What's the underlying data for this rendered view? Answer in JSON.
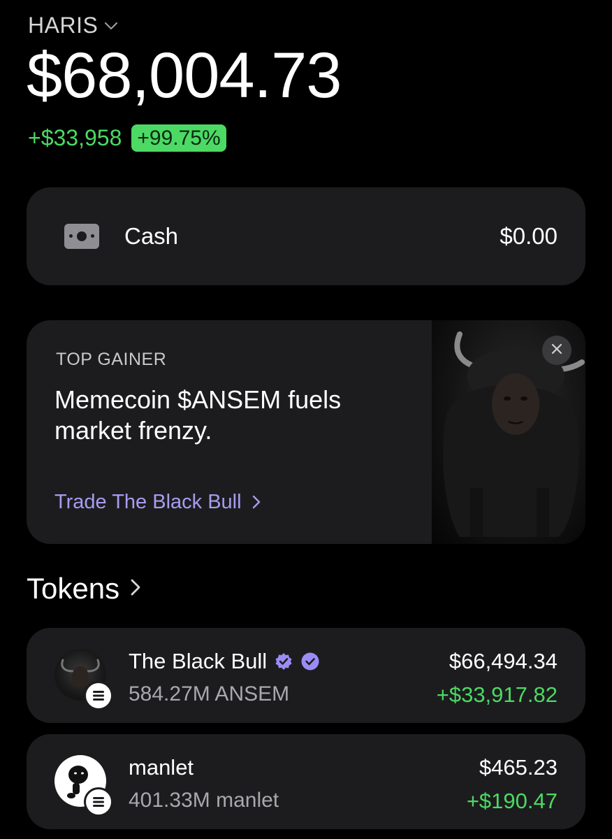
{
  "header": {
    "account_name": "HARIS",
    "account_chevron_icon": "chevron-down-icon",
    "balance": "$68,004.73",
    "change_amount": "+$33,958",
    "change_percent": "+99.75%"
  },
  "cash": {
    "icon": "cash-icon",
    "label": "Cash",
    "value": "$0.00"
  },
  "promo": {
    "eyebrow": "TOP GAINER",
    "headline": "Memecoin $ANSEM fuels market frenzy.",
    "cta": "Trade The Black Bull",
    "cta_icon": "chevron-right-icon",
    "image": "black-bull-image",
    "close_icon": "close-icon"
  },
  "tokens": {
    "title": "Tokens",
    "title_icon": "chevron-right-icon",
    "items": [
      {
        "name": "The Black Bull",
        "badges": [
          "verified-icon",
          "verified-icon"
        ],
        "amount": "584.27M ANSEM",
        "value": "$66,494.34",
        "change": "+$33,917.82",
        "avatar": "black-bull-avatar",
        "chain_badge": "solana-icon"
      },
      {
        "name": "manlet",
        "amount": "401.33M manlet",
        "value": "$465.23",
        "change": "+$190.47",
        "avatar": "manlet-avatar",
        "chain_badge": "solana-icon"
      }
    ]
  },
  "colors": {
    "background": "#000000",
    "card": "#1c1c1e",
    "positive": "#4cd964",
    "accent_purple": "#a79cf0",
    "verified_purple": "#9b8cf5"
  }
}
